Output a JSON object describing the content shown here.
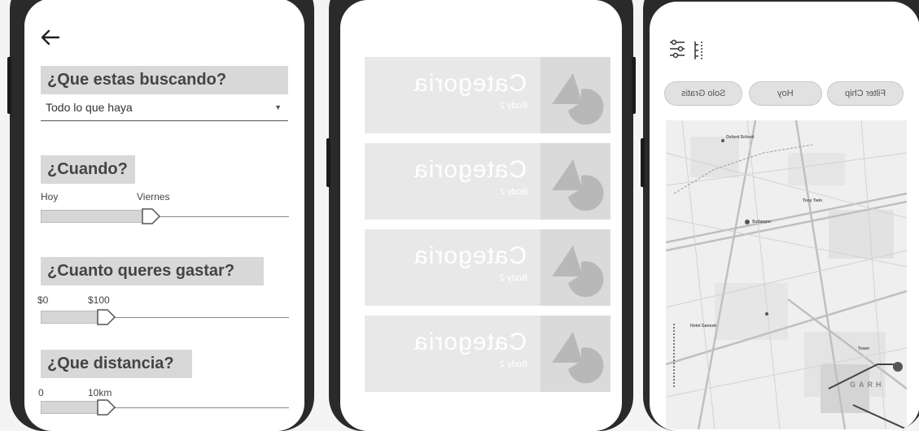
{
  "screen1": {
    "question": "¿Que estas buscando?",
    "select_value": "Todo lo que haya",
    "when": {
      "heading": "¿Cuando?",
      "min_label": "Hoy",
      "max_label": "Viernes",
      "level": 0.42
    },
    "budget": {
      "heading": "¿Cuanto queres gastar?",
      "min_label": "$0",
      "max_label": "$100",
      "level": 0.24
    },
    "distance": {
      "heading": "¿Que distancia?",
      "min_label": "0",
      "max_label": "10km",
      "level": 0.24
    }
  },
  "screen2": {
    "cards": [
      {
        "title": "Categoria",
        "subtitle": "Body 2"
      },
      {
        "title": "Categoria",
        "subtitle": "Body 2"
      },
      {
        "title": "Categoria",
        "subtitle": "Body 2"
      },
      {
        "title": "Categoria",
        "subtitle": "Body 2"
      }
    ]
  },
  "screen3": {
    "chips": [
      "Solo Gratis",
      "Hoy",
      "Filter Chip"
    ],
    "map_labels": [
      "Oxford School",
      "Tony Twin",
      "Sultanpur",
      "Hotel Ganesh",
      "Tower",
      "GARH"
    ]
  },
  "colors": {
    "phone_frame": "#2a2a2a",
    "screen_bg": "#ffffff",
    "heading_bg": "#d8d8d8",
    "card_bg": "#e8e8e8",
    "chip_bg": "#e1e1e1"
  }
}
